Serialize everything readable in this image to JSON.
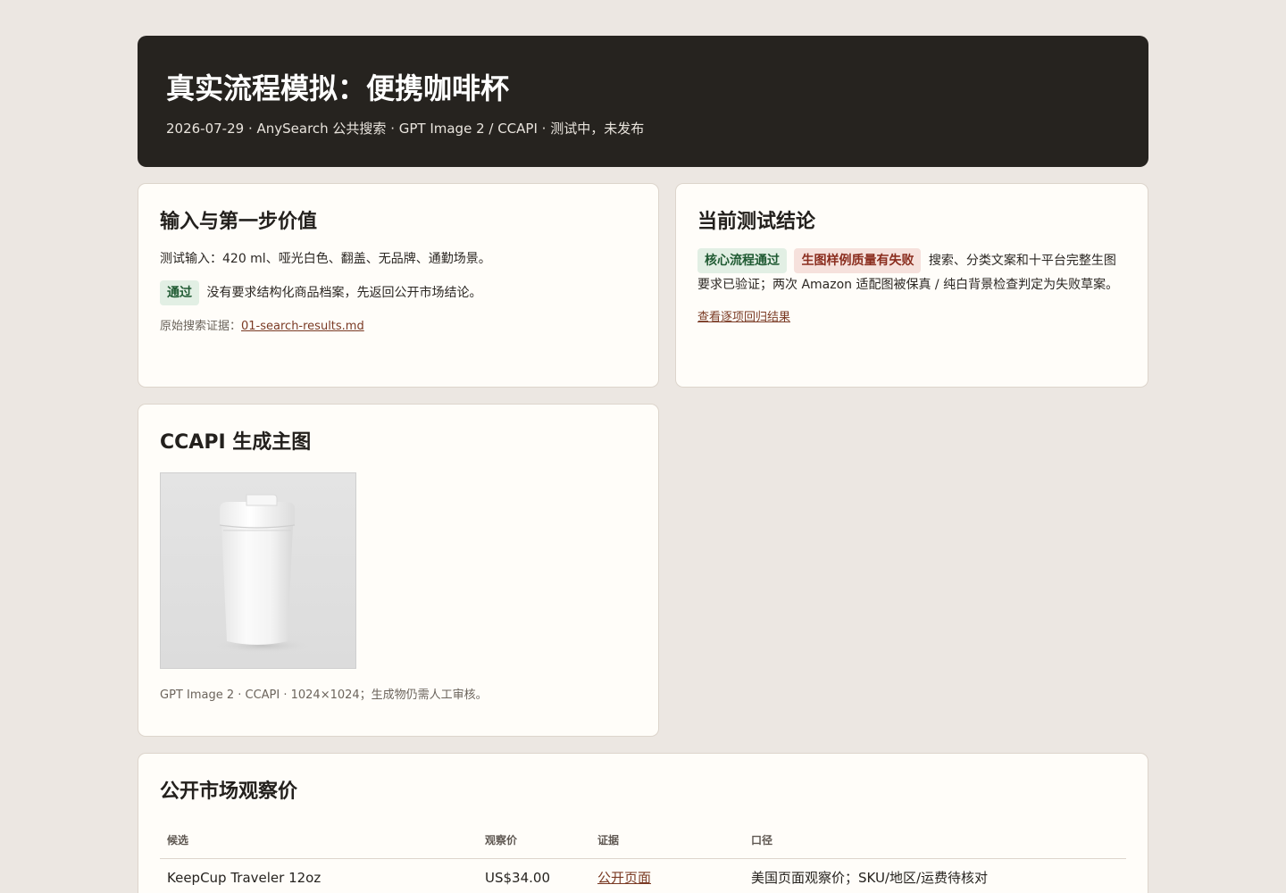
{
  "header": {
    "title": "真实流程模拟：便携咖啡杯",
    "subtitle": "2026-07-29 · AnySearch 公共搜索 · GPT Image 2 / CCAPI · 测试中，未发布"
  },
  "input_card": {
    "title": "输入与第一步价值",
    "input_text": "测试输入：420 ml、哑光白色、翻盖、无品牌、通勤场景。",
    "badge": "通过",
    "badge_text": "没有要求结构化商品档案，先返回公开市场结论。",
    "evidence_label": "原始搜索证据：",
    "evidence_link": "01-search-results.md"
  },
  "result_card": {
    "title": "当前测试结论",
    "badge_pass": "核心流程通过",
    "badge_fail": "生图样例质量有失败",
    "summary": "搜索、分类文案和十平台完整生图要求已验证；两次 Amazon 适配图被保真 / 纯白背景检查判定为失败草案。",
    "link": "查看逐项回归结果"
  },
  "image_card": {
    "title": "CCAPI 生成主图",
    "image_alt": "哑光白色翻盖便携咖啡杯",
    "caption": "GPT Image 2 · CCAPI · 1024×1024；生成物仍需人工审核。"
  },
  "market_card": {
    "title": "公开市场观察价",
    "columns": [
      "候选",
      "观察价",
      "证据",
      "口径"
    ],
    "rows": [
      {
        "candidate": "KeepCup Traveler 12oz",
        "price": "US$34.00",
        "evidence": "公开页面",
        "basis": "美国页面观察价；SKU/地区/运费待核对"
      }
    ]
  },
  "colors": {
    "page_bg": "#ece7e2",
    "header_bg": "#26231f",
    "card_bg": "#fffdf9",
    "link": "#7a3a24",
    "pass_badge_bg": "#e2efe4",
    "fail_badge_bg": "#f6e1dc"
  }
}
